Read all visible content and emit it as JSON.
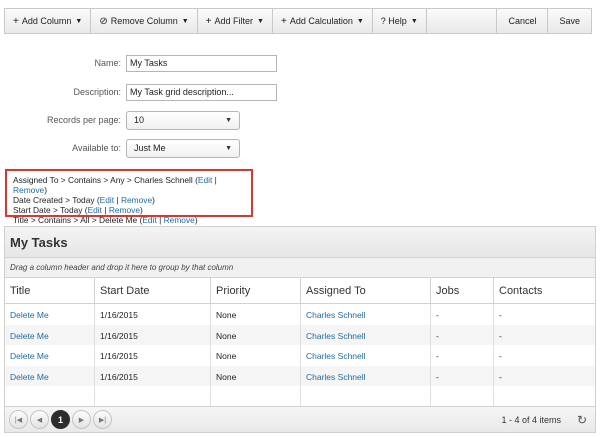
{
  "toolbar": {
    "add_column": "Add Column",
    "remove_column": "Remove Column",
    "add_filter": "Add Filter",
    "add_calculation": "Add Calculation",
    "help": "? Help",
    "cancel": "Cancel",
    "save": "Save",
    "plus_glyph": "+",
    "remove_glyph": "⊘",
    "caret_glyph": "▼"
  },
  "form": {
    "name_label": "Name:",
    "name_value": "My Tasks",
    "description_label": "Description:",
    "description_value": "My Task grid description...",
    "records_label": "Records per page:",
    "records_value": "10",
    "available_label": "Available to:",
    "available_value": "Just Me"
  },
  "filters": [
    {
      "text": "Assigned To > Contains > Any > Charles Schnell (",
      "edit": "Edit",
      "sep": " | ",
      "remove": "Remove",
      "close": ")"
    },
    {
      "text": "Date Created > Today (",
      "edit": "Edit",
      "sep": " | ",
      "remove": "Remove",
      "close": ")"
    },
    {
      "text": "Start Date > Today (",
      "edit": "Edit",
      "sep": " | ",
      "remove": "Remove",
      "close": ")"
    },
    {
      "text": "Title > Contains > All > Delete Me (",
      "edit": "Edit",
      "sep": " | ",
      "remove": "Remove",
      "close": ")"
    }
  ],
  "grid": {
    "title": "My Tasks",
    "group_hint": "Drag a column header and drop it here to group by that column",
    "columns": [
      "Title",
      "Start Date",
      "Priority",
      "Assigned To",
      "Jobs",
      "Contacts"
    ],
    "rows": [
      [
        "Delete Me",
        "1/16/2015",
        "None",
        "Charles Schnell",
        "-",
        "-"
      ],
      [
        "Delete Me",
        "1/16/2015",
        "None",
        "Charles Schnell",
        "-",
        "-"
      ],
      [
        "Delete Me",
        "1/16/2015",
        "None",
        "Charles Schnell",
        "-",
        "-"
      ],
      [
        "Delete Me",
        "1/16/2015",
        "None",
        "Charles Schnell",
        "-",
        "-"
      ]
    ]
  },
  "pager": {
    "first": "|◀",
    "prev": "◀",
    "current_page": "1",
    "next": "▶",
    "last": "▶|",
    "info": "1 - 4 of 4 items",
    "refresh_glyph": "↻"
  }
}
